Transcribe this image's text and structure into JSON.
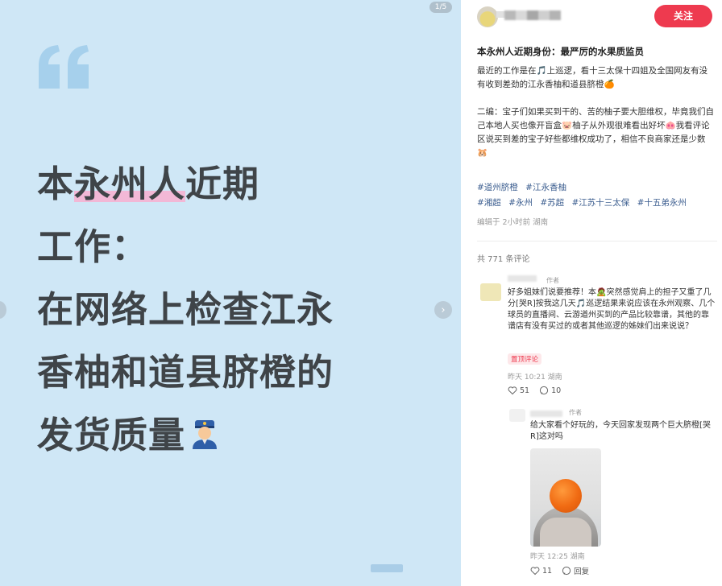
{
  "image_panel": {
    "page_indicator": "1/5",
    "headline_lines": [
      {
        "pre": "本",
        "hl": "永州人",
        "post": "近期"
      },
      {
        "text": "工作："
      },
      {
        "text": "在网络上检查江永"
      },
      {
        "text": "香柚和道县脐橙的"
      },
      {
        "text": "发货质量"
      }
    ],
    "next_arrow": "›"
  },
  "header": {
    "follow_label": "关注"
  },
  "post": {
    "title": "本永州人近期身份：最严厉的水果质监员",
    "body_paragraphs": [
      "最近的工作是在🎵上巡逻，看十三太保十四姐及全国网友有没有收到差劲的江永香柚和道县脐橙🍊",
      "二编：宝子们如果买到干的、苦的柚子要大胆维权，毕竟我们自己本地人买也像开盲盒🐷柚子从外观很难看出好坏🐽我看评论区说买到差的宝子好些都维权成功了，相信不良商家还是少数🐹"
    ],
    "tags_line1": [
      "#道州脐橙",
      "#江永香柚"
    ],
    "tags_line2": [
      "#湘超",
      "#永州",
      "#苏超",
      "#江苏十三太保",
      "#十五弟永州"
    ],
    "edit_meta": "编辑于 2小时前 湖南",
    "comments_count": "共 771 条评论"
  },
  "comments": [
    {
      "author_tag": "作者",
      "text": "好多姐妹们说要推荐！本🧟突然感觉肩上的担子又重了几分[哭R]按我这几天🎵巡逻结果来说应该在永州观察、几个球员的直播间、云游道州买到的产品比较靠谱，其他的靠谱店有没有买过的或者其他巡逻的姊妹们出来说说？",
      "badge": "置顶评论",
      "time": "昨天 10:21 湖南",
      "likes": "51",
      "replies": "10"
    },
    {
      "author_tag": "作者",
      "text": "给大家看个好玩的，今天回家发现两个巨大脐橙[哭R]这对吗",
      "time": "昨天 12:25 湖南",
      "likes": "11",
      "reply_label": "回复"
    }
  ],
  "colors": {
    "accent": "#ee3a4f",
    "image_bg": "#cfe7f6",
    "headline": "#3f4448",
    "highlight": "#f2b8d6",
    "tag_link": "#3b5d8f"
  },
  "icons": [
    "quote-icon",
    "police-officer-emoji",
    "chevron-right-icon",
    "heart-icon",
    "comment-icon"
  ]
}
